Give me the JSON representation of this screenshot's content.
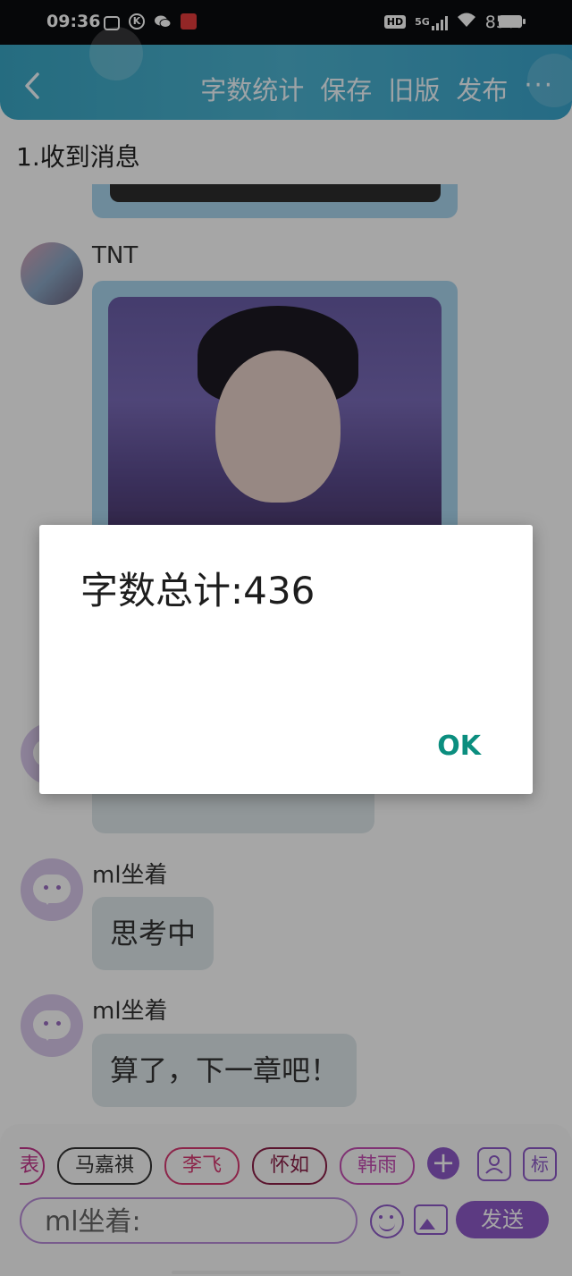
{
  "status_bar": {
    "time": "09:36",
    "hd": "HD",
    "network": "5G",
    "battery_pct": "85%"
  },
  "header": {
    "menu": [
      "字数统计",
      "保存",
      "旧版",
      "发布"
    ],
    "more": "···"
  },
  "chapter_title": "1.收到消息",
  "messages": [
    {
      "sender": "TNT"
    },
    {
      "sender": "ml坐着",
      "text": "思考中"
    },
    {
      "sender": "ml坐着",
      "text": "算了，下一章吧！"
    }
  ],
  "dialog": {
    "message": "字数总计:436",
    "ok_label": "OK"
  },
  "toolbar": {
    "chips": [
      "马嘉祺",
      "李飞",
      "怀如",
      "韩雨"
    ],
    "chip_partial": "表",
    "add_label": "+",
    "tag_label": "标",
    "input_value": "ml坐着:",
    "send_label": "发送"
  }
}
